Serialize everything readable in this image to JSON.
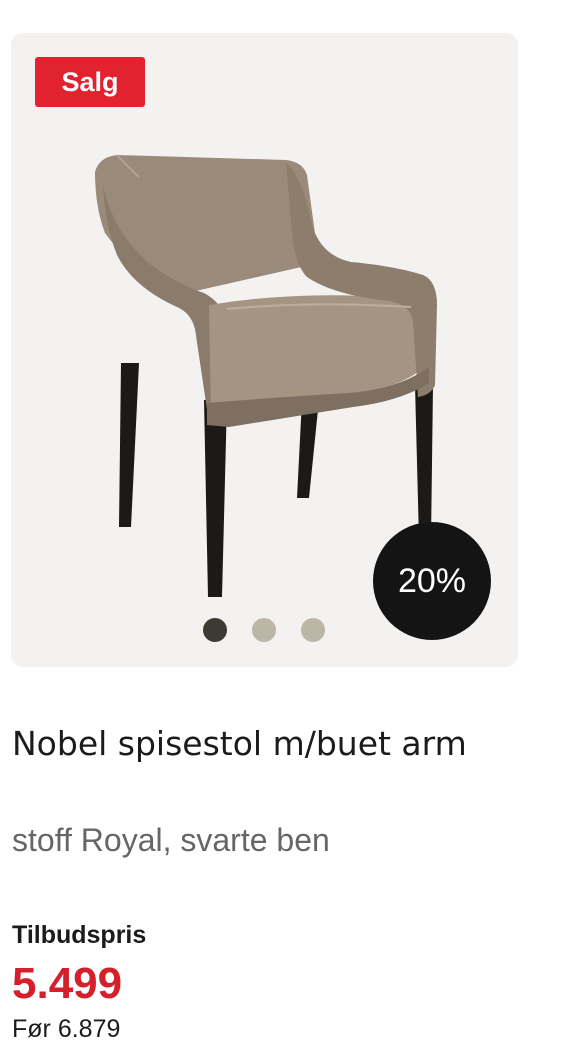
{
  "product": {
    "badge": "Salg",
    "discount": "20%",
    "title": "Nobel spisestol m/buet arm",
    "subtitle": "stoff Royal, svarte ben",
    "price_label": "Tilbudspris",
    "price": "5.499",
    "before_price": "Før 6.879",
    "image_dots": {
      "count": 3,
      "active_index": 0
    }
  },
  "colors": {
    "sale_red": "#e2222e",
    "price_red": "#d5202c",
    "discount_badge": "#141414",
    "card_background": "#f3f2f0",
    "chair_fabric": "#9a8a79",
    "chair_legs": "#1c1a17"
  }
}
